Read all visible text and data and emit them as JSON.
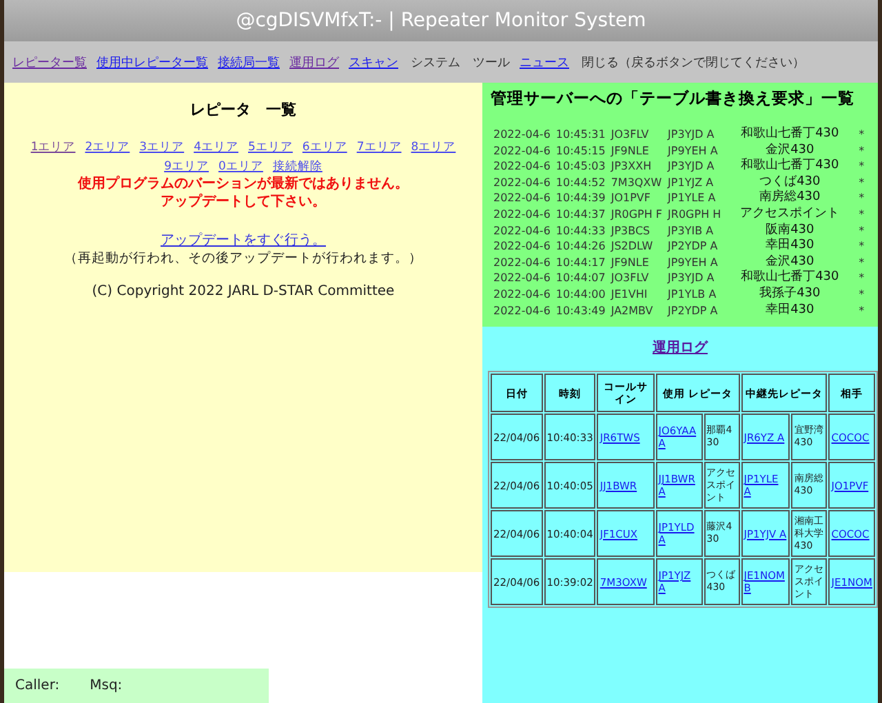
{
  "window": {
    "title": "@cgDISVMfxT:- | Repeater Monitor System"
  },
  "nav": [
    {
      "label": "レピーター覧",
      "kind": "link",
      "visited": true
    },
    {
      "label": "使用中レピーター覧",
      "kind": "link",
      "visited": false
    },
    {
      "label": "接続局一覧",
      "kind": "link",
      "visited": false
    },
    {
      "label": "運用ログ",
      "kind": "link",
      "visited": true
    },
    {
      "label": "スキャン",
      "kind": "link",
      "visited": false
    },
    {
      "label": "システム",
      "kind": "menu"
    },
    {
      "label": "ツール",
      "kind": "menu"
    },
    {
      "label": "ニュース",
      "kind": "link",
      "visited": false
    },
    {
      "label": "閉じる（戻るボタンで閉じてください）",
      "kind": "menu"
    }
  ],
  "repeater_list": {
    "title": "レピータ　一覧",
    "areas": [
      {
        "label": "1エリア",
        "visited": true
      },
      {
        "label": "2エリア",
        "visited": false
      },
      {
        "label": "3エリア",
        "visited": false
      },
      {
        "label": "4エリア",
        "visited": false
      },
      {
        "label": "5エリア",
        "visited": false
      },
      {
        "label": "6エリア",
        "visited": false
      },
      {
        "label": "7エリア",
        "visited": false
      },
      {
        "label": "8エリア",
        "visited": false
      },
      {
        "label": "9エリア",
        "visited": false
      },
      {
        "label": "0エリア",
        "visited": false
      },
      {
        "label": "接続解除",
        "visited": false
      }
    ],
    "warning": [
      "使用プログラムのバーションが最新ではありません。",
      "アップデートして下さい。"
    ],
    "update_link": "アップデートをすぐ行う。",
    "update_note": "（再起動が行われ、その後アップデートが行われます。）",
    "copyright": "(C) Copyright 2022 JARL D-STAR Committee"
  },
  "caller_bar": {
    "caller_label": "Caller:",
    "msg_label": "Msq:"
  },
  "table_requests": {
    "title": "管理サーバーへの「テーブル書き換え要求」一覧",
    "rows": [
      [
        "2022-04-6",
        "10:45:31",
        "JO3FLV",
        "JP3YJD A",
        "和歌山七番丁430",
        "*"
      ],
      [
        "2022-04-6",
        "10:45:15",
        "JF9NLE",
        "JP9YEH A",
        "金沢430",
        "*"
      ],
      [
        "2022-04-6",
        "10:45:03",
        "JP3XXH",
        "JP3YJD A",
        "和歌山七番丁430",
        "*"
      ],
      [
        "2022-04-6",
        "10:44:52",
        "7M3QXW",
        "JP1YJZ A",
        "つくば430",
        "*"
      ],
      [
        "2022-04-6",
        "10:44:39",
        "JO1PVF",
        "JP1YLE A",
        "南房総430",
        "*"
      ],
      [
        "2022-04-6",
        "10:44:37",
        "JR0GPH F",
        "JR0GPH H",
        "アクセスポイント",
        "*"
      ],
      [
        "2022-04-6",
        "10:44:33",
        "JP3BCS",
        "JP3YIB A",
        "阪南430",
        "*"
      ],
      [
        "2022-04-6",
        "10:44:26",
        "JS2DLW",
        "JP2YDP A",
        "幸田430",
        "*"
      ],
      [
        "2022-04-6",
        "10:44:17",
        "JF9NLE",
        "JP9YEH A",
        "金沢430",
        "*"
      ],
      [
        "2022-04-6",
        "10:44:07",
        "JO3FLV",
        "JP3YJD A",
        "和歌山七番丁430",
        "*"
      ],
      [
        "2022-04-6",
        "10:44:00",
        "JE1VHI",
        "JP1YLB A",
        "我孫子430",
        "*"
      ],
      [
        "2022-04-6",
        "10:43:49",
        "JA2MBV",
        "JP2YDP A",
        "幸田430",
        "*"
      ]
    ]
  },
  "operation_log": {
    "title": "運用ログ",
    "columns": [
      "日付",
      "時刻",
      "コールサイン",
      "使用 レピータ",
      "中継先レピータ",
      "相手"
    ],
    "rows": [
      {
        "date": "22/04/06",
        "time": "10:40:33",
        "callsign": "JR6TWS",
        "repeater": "JO6YAA A",
        "repeater_name": "那覇430",
        "destination": "JR6YZ A",
        "destination_name": "宜野湾430",
        "partner": "COCOC"
      },
      {
        "date": "22/04/06",
        "time": "10:40:05",
        "callsign": "JJ1BWR",
        "repeater": "JJ1BWR A",
        "repeater_name": "アクセスポイント",
        "destination": "JP1YLE A",
        "destination_name": "南房総430",
        "partner": "JO1PVF"
      },
      {
        "date": "22/04/06",
        "time": "10:40:04",
        "callsign": "JF1CUX",
        "repeater": "JP1YLD A",
        "repeater_name": "藤沢430",
        "destination": "JP1YJV A",
        "destination_name": "湘南工科大学430",
        "partner": "COCOC"
      },
      {
        "date": "22/04/06",
        "time": "10:39:02",
        "callsign": "7M3OXW",
        "repeater": "JP1YJZ A",
        "repeater_name": "つくば430",
        "destination": "JE1NOM B",
        "destination_name": "アクセスポイント",
        "partner": "JE1NOM"
      }
    ]
  }
}
